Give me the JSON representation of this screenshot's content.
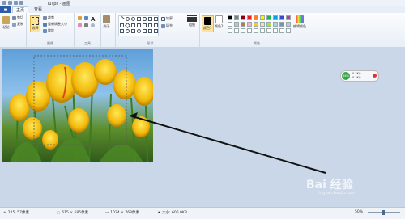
{
  "window": {
    "title": "Tulips - 画图"
  },
  "tabs": {
    "file": "",
    "home": "主页",
    "view": "查看"
  },
  "ribbon": {
    "clipboard": {
      "paste": "粘贴",
      "cut": "剪切",
      "copy": "复制",
      "label": ""
    },
    "image": {
      "select": "选择",
      "crop": "裁剪",
      "resize": "重新调整大小",
      "rotate": "旋转",
      "label": "图像"
    },
    "tools": {
      "label": "工具"
    },
    "brushes": {
      "label": "刷子"
    },
    "shapes": {
      "outline": "轮廓",
      "fill": "填充",
      "label": "形状"
    },
    "size": {
      "label": "粗细"
    },
    "colors": {
      "color1": "颜色1",
      "color2": "颜色2",
      "edit": "编辑颜色",
      "label": "颜色",
      "palette": [
        "#000000",
        "#7f7f7f",
        "#880015",
        "#ed1c24",
        "#ff7f27",
        "#fff200",
        "#22b14c",
        "#00a2e8",
        "#3f48cc",
        "#a349a4",
        "#ffffff",
        "#c3c3c3",
        "#b97a57",
        "#ffaec9",
        "#ffc90e",
        "#efe4b0",
        "#b5e61d",
        "#99d9ea",
        "#7092be",
        "#c8bfe7"
      ]
    }
  },
  "status": {
    "cursor": "225, 57像素",
    "selection": "615 × 585像素",
    "image_size": "1024 × 768像素",
    "file_size": "大小: 606.0KB",
    "zoom": "50%"
  },
  "badge": {
    "percent": "46%",
    "line1": "0.3K/s",
    "line2": "0.3K/s"
  },
  "watermark": {
    "brand": "Bai 经验",
    "sub": "jingyan.baidu.com"
  }
}
